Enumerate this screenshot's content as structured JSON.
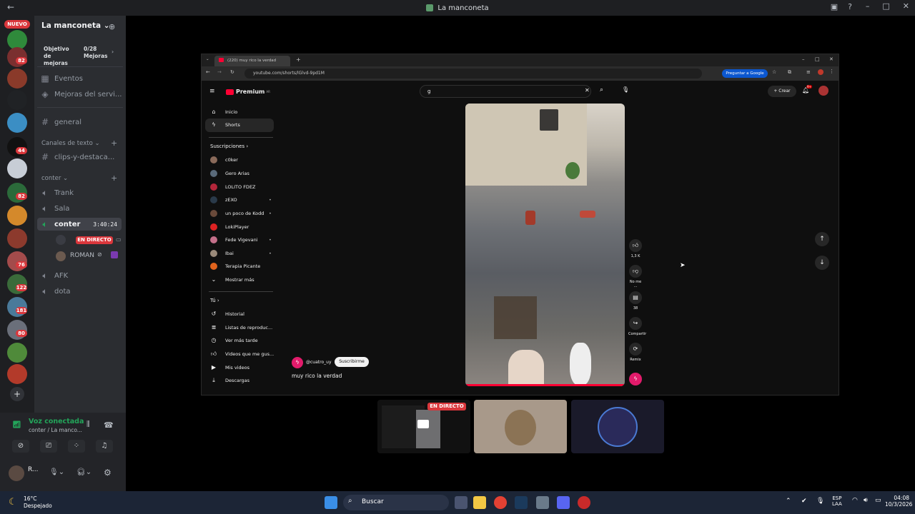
{
  "window": {
    "title": "La manconeta"
  },
  "servers": {
    "nuevo": "NUEVO",
    "badges": [
      "82",
      "44",
      "82",
      "76",
      "122",
      "181",
      "80"
    ]
  },
  "guild": {
    "name": "La manconeta",
    "goal_label": "Objetivo de mejoras",
    "goal_value": "0/28 Mejoras",
    "items": [
      {
        "label": "Eventos"
      },
      {
        "label": "Mejoras del servi..."
      }
    ],
    "general": "general",
    "text_cat": "Canales de texto",
    "clips": "clips-y-destaca...",
    "voice_cat": "conter",
    "voice": [
      {
        "label": "Trank"
      },
      {
        "label": "Sala"
      },
      {
        "label": "conter",
        "time": "3:40:24"
      }
    ],
    "live_badge": "EN DIRECTO",
    "member": "ROMAN",
    "afk": "AFK",
    "dota": "dota"
  },
  "voice_panel": {
    "status": "Voz conectada",
    "location": "conter / La manco...",
    "user": "R..."
  },
  "browser": {
    "tab_title": "(220) muy rico la verdad",
    "url": "youtube.com/shorts/lGlvd-9pd1M",
    "ask_google": "Preguntar a Google"
  },
  "youtube": {
    "logo": "Premium",
    "logo_sup": "AR",
    "search_value": "g",
    "create": "Crear",
    "notif": "9+",
    "nav": [
      {
        "label": "Inicio"
      },
      {
        "label": "Shorts"
      }
    ],
    "subs_header": "Suscripciones",
    "channels": [
      {
        "label": "c0ker"
      },
      {
        "label": "Gero Arias"
      },
      {
        "label": "LOLITO FDEZ"
      },
      {
        "label": "zEXO"
      },
      {
        "label": "un poco de Kodd"
      },
      {
        "label": "LokiPlayer"
      },
      {
        "label": "Fede Vigevani"
      },
      {
        "label": "Ibai"
      },
      {
        "label": "Terapia Picante"
      },
      {
        "label": "Mostrar más"
      }
    ],
    "you_header": "Tú",
    "you": [
      {
        "label": "Historial"
      },
      {
        "label": "Listas de reproduc..."
      },
      {
        "label": "Ver más tarde"
      },
      {
        "label": "Videos que me gus..."
      },
      {
        "label": "Mis videos"
      },
      {
        "label": "Descargas"
      }
    ],
    "short": {
      "channel": "@cuatro_uy",
      "subscribe": "Suscribirme",
      "title": "muy rico la verdad",
      "likes": "1,3 K",
      "dislike": "No me ...",
      "comments": "38",
      "share": "Compartir",
      "remix": "Remix"
    }
  },
  "stream_tiles": {
    "live": "EN DIRECTO"
  },
  "taskbar": {
    "weather_temp": "16°C",
    "weather_desc": "Despejado",
    "search": "Buscar",
    "lang": "ESP",
    "lang2": "LAA",
    "time": "04:08",
    "date": "10/3/2026"
  }
}
